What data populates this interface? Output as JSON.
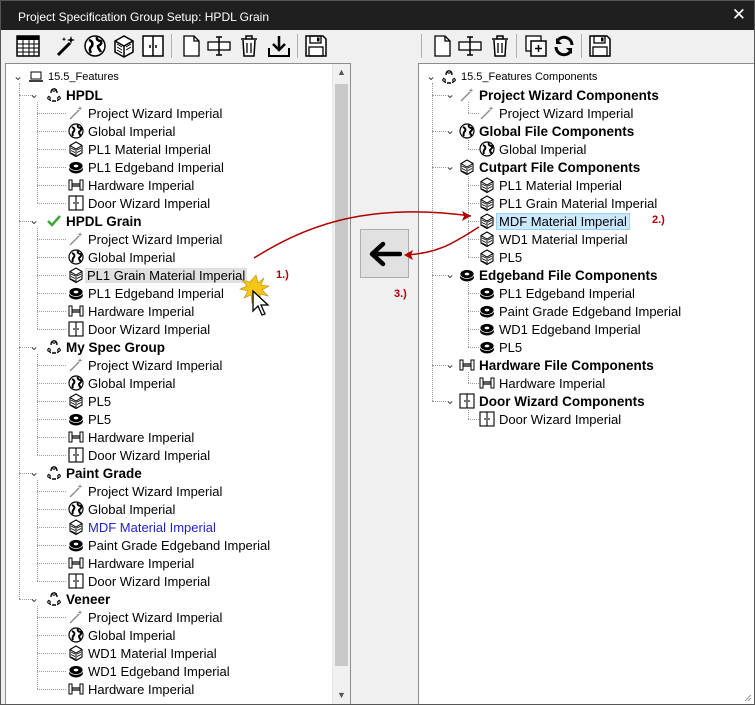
{
  "window": {
    "title": "Project Specification Group Setup: HPDL Grain",
    "close_glyph": "✕"
  },
  "left_tree": {
    "root": "15.5_Features",
    "groups": [
      {
        "label": "HPDL",
        "items": [
          {
            "label": "Project Wizard Imperial",
            "icon": "wand-icon"
          },
          {
            "label": "Global Imperial",
            "icon": "globe-icon"
          },
          {
            "label": "PL1 Material Imperial",
            "icon": "material-icon"
          },
          {
            "label": "PL1 Edgeband Imperial",
            "icon": "edgeband-icon"
          },
          {
            "label": "Hardware Imperial",
            "icon": "hardware-icon"
          },
          {
            "label": "Door Wizard Imperial",
            "icon": "door-icon"
          }
        ]
      },
      {
        "label": "HPDL Grain",
        "items": [
          {
            "label": "Project Wizard Imperial",
            "icon": "wand-icon"
          },
          {
            "label": "Global Imperial",
            "icon": "globe-icon"
          },
          {
            "label": "PL1 Grain Material Imperial",
            "icon": "material-icon"
          },
          {
            "label": "PL1 Edgeband Imperial",
            "icon": "edgeband-icon"
          },
          {
            "label": "Hardware Imperial",
            "icon": "hardware-icon"
          },
          {
            "label": "Door Wizard Imperial",
            "icon": "door-icon"
          }
        ]
      },
      {
        "label": "My Spec Group",
        "items": [
          {
            "label": "Project Wizard Imperial",
            "icon": "wand-icon"
          },
          {
            "label": "Global Imperial",
            "icon": "globe-icon"
          },
          {
            "label": "PL5",
            "icon": "material-icon"
          },
          {
            "label": "PL5",
            "icon": "edgeband-icon"
          },
          {
            "label": "Hardware Imperial",
            "icon": "hardware-icon"
          },
          {
            "label": "Door Wizard Imperial",
            "icon": "door-icon"
          }
        ]
      },
      {
        "label": "Paint Grade",
        "items": [
          {
            "label": "Project Wizard Imperial",
            "icon": "wand-icon"
          },
          {
            "label": "Global Imperial",
            "icon": "globe-icon"
          },
          {
            "label": "MDF Material Imperial",
            "icon": "material-icon"
          },
          {
            "label": "Paint Grade Edgeband Imperial",
            "icon": "edgeband-icon"
          },
          {
            "label": "Hardware Imperial",
            "icon": "hardware-icon"
          },
          {
            "label": "Door Wizard Imperial",
            "icon": "door-icon"
          }
        ]
      },
      {
        "label": "Veneer",
        "items": [
          {
            "label": "Project Wizard Imperial",
            "icon": "wand-icon"
          },
          {
            "label": "Global Imperial",
            "icon": "globe-icon"
          },
          {
            "label": "WD1 Material Imperial",
            "icon": "material-icon"
          },
          {
            "label": "WD1 Edgeband Imperial",
            "icon": "edgeband-icon"
          },
          {
            "label": "Hardware Imperial",
            "icon": "hardware-icon"
          }
        ]
      }
    ]
  },
  "right_tree": {
    "root": "15.5_Features Components",
    "groups": [
      {
        "label": "Project Wizard Components",
        "icon": "wand-icon",
        "items": [
          {
            "label": "Project Wizard Imperial",
            "icon": "wand-icon"
          }
        ]
      },
      {
        "label": "Global File Components",
        "icon": "globe-icon",
        "items": [
          {
            "label": "Global Imperial",
            "icon": "globe-icon"
          }
        ]
      },
      {
        "label": "Cutpart File Components",
        "icon": "material-icon",
        "items": [
          {
            "label": "PL1 Material Imperial",
            "icon": "material-icon"
          },
          {
            "label": "PL1 Grain Material Imperial",
            "icon": "material-icon"
          },
          {
            "label": "MDF Material Imperial",
            "icon": "material-icon"
          },
          {
            "label": "WD1 Material Imperial",
            "icon": "material-icon"
          },
          {
            "label": "PL5",
            "icon": "material-icon"
          }
        ]
      },
      {
        "label": "Edgeband File Components",
        "icon": "edgeband-icon",
        "items": [
          {
            "label": "PL1 Edgeband Imperial",
            "icon": "edgeband-icon"
          },
          {
            "label": "Paint Grade Edgeband Imperial",
            "icon": "edgeband-icon"
          },
          {
            "label": "WD1 Edgeband Imperial",
            "icon": "edgeband-icon"
          },
          {
            "label": "PL5",
            "icon": "edgeband-icon"
          }
        ]
      },
      {
        "label": "Hardware File Components",
        "icon": "hardware-icon",
        "items": [
          {
            "label": "Hardware Imperial",
            "icon": "hardware-icon"
          }
        ]
      },
      {
        "label": "Door Wizard Components",
        "icon": "door-icon",
        "items": [
          {
            "label": "Door Wizard Imperial",
            "icon": "door-icon"
          }
        ]
      }
    ]
  },
  "annotations": {
    "step1": "1.)",
    "step2": "2.)",
    "step3": "3.)"
  },
  "colors": {
    "annotation": "#b00000",
    "selection": "#cce8ff",
    "link_text": "#1f1fcf",
    "check": "#3aa83a"
  }
}
